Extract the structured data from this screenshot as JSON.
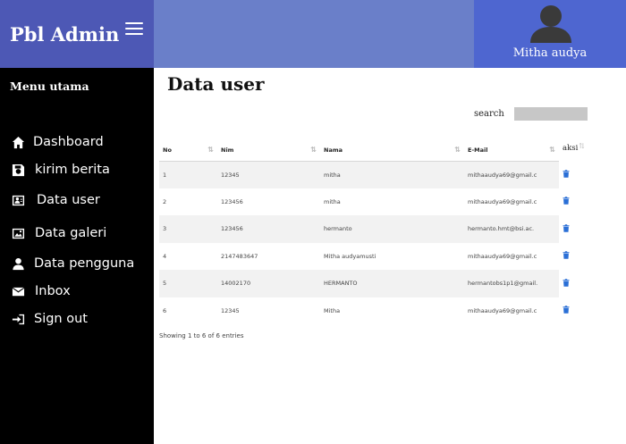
{
  "header": {
    "brand": "Pbl Admin",
    "user_name": "Mitha audya",
    "colors": {
      "brand_bg": "#4d58b5",
      "topbar_bg": "#6a7fc9",
      "userbox_bg": "#4e66d0"
    }
  },
  "sidebar": {
    "heading": "Menu utama",
    "items": [
      {
        "label": "Dashboard",
        "icon": "home-icon"
      },
      {
        "label": "kirim berita",
        "icon": "save-icon"
      },
      {
        "label": "Data user",
        "icon": "id-card-icon"
      },
      {
        "label": "Data galeri",
        "icon": "image-icon"
      },
      {
        "label": "Data pengguna",
        "icon": "user-icon"
      },
      {
        "label": "Inbox",
        "icon": "envelope-icon"
      },
      {
        "label": "Sign out",
        "icon": "sign-out-icon"
      }
    ]
  },
  "main": {
    "title": "Data user",
    "search": {
      "label": "search",
      "value": ""
    },
    "table": {
      "columns": [
        "No",
        "Nim",
        "Nama",
        "E-Mail",
        "aksi"
      ],
      "rows": [
        [
          "1",
          "12345",
          "mitha",
          "mithaaudya69@gmail.c"
        ],
        [
          "2",
          "123456",
          "mitha",
          "mithaaudya69@gmail.c"
        ],
        [
          "3",
          "123456",
          "hermanto",
          "hermanto.hmt@bsi.ac."
        ],
        [
          "4",
          "2147483647",
          "Mitha audyamusti",
          "mithaaudya69@gmail.c"
        ],
        [
          "5",
          "14002170",
          "HERMANTO",
          "hermantobs1p1@gmail."
        ],
        [
          "6",
          "12345",
          "Mitha",
          "mithaaudya69@gmail.c"
        ]
      ],
      "action_icon": "trash-icon",
      "info": "Showing 1 to 6 of 6 entries"
    }
  }
}
